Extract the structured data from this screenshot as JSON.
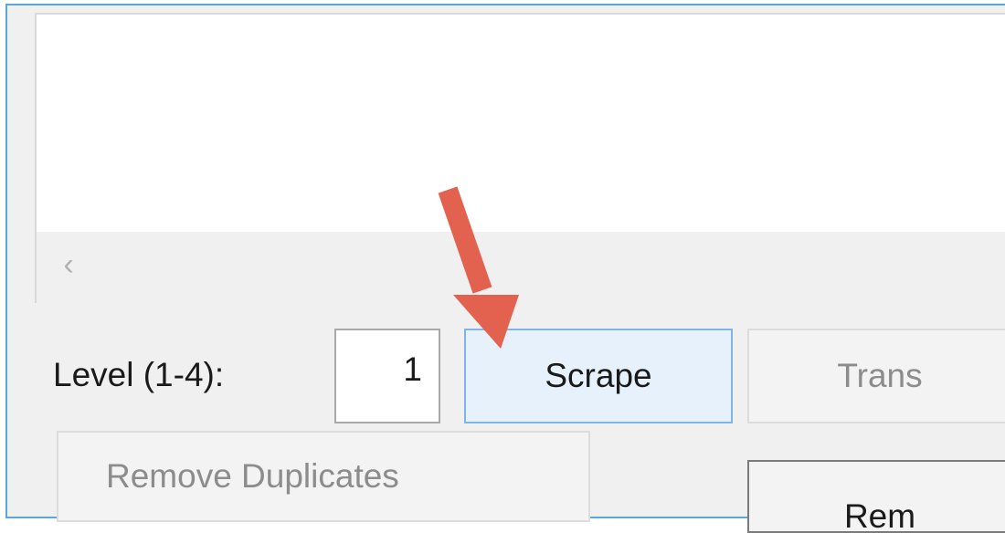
{
  "controls": {
    "level_label": "Level (1-4):",
    "level_value": "1",
    "scrape_label": "Scrape",
    "trans_label": "Trans",
    "remove_duplicates_label": "Remove Duplicates",
    "remove_label": "Rem"
  },
  "scrollbar": {
    "left_glyph": "‹"
  },
  "annotation": {
    "arrow_color": "#e2624f"
  },
  "colors": {
    "window_border": "#5aa7d9",
    "scrape_button_bg": "#e6f1fb",
    "scrape_button_border": "#7eb4ea"
  }
}
